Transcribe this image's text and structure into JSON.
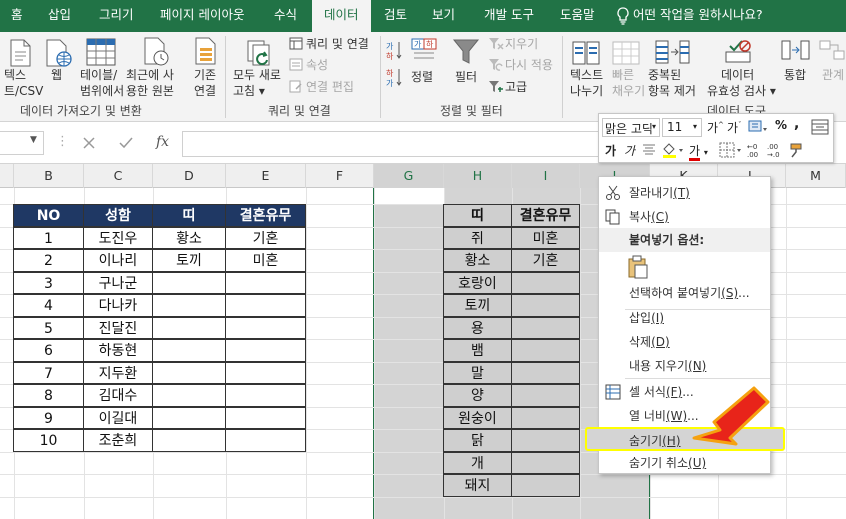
{
  "tabs": [
    "홈",
    "삽입",
    "그리기",
    "페이지 레이아웃",
    "수식",
    "데이터",
    "검토",
    "보기",
    "개발 도구",
    "도움말",
    "어떤 작업을 원하시나요?"
  ],
  "ribbon": {
    "get_data": {
      "btn_text_line1": "텍스",
      "btn_text_line2": "트/CSV",
      "btn_web": "웹",
      "btn_table_line1": "테이블/",
      "btn_table_line2": "범위에서",
      "btn_recent_line1": "최근에 사",
      "btn_recent_line2": "용한 원본",
      "btn_existing_line1": "기존",
      "btn_existing_line2": "연결",
      "group_label": "데이터 가져오기 및 변환"
    },
    "queries": {
      "refresh_line1": "모두 새로",
      "refresh_line2": "고침",
      "queries_conn": "쿼리 및 연결",
      "properties": "속성",
      "edit_links": "연결 편집",
      "group_label": "쿼리 및 연결"
    },
    "sort_filter": {
      "sort": "정렬",
      "filter": "필터",
      "clear": "지우기",
      "reapply": "다시 적용",
      "advanced": "고급",
      "group_label": "정렬 및 필터"
    },
    "data_tools": {
      "text_col_line1": "텍스트",
      "text_col_line2": "나누기",
      "flash_line1": "빠른",
      "flash_line2": "채우기",
      "remove_dup_line1": "중복된",
      "remove_dup_line2": "항목 제거",
      "validation_line1": "데이터",
      "validation_line2": "유효성 검사",
      "consolidate": "통합",
      "relations": "관계",
      "group_label": "데이터 도구"
    }
  },
  "formula_bar": {
    "fx": "fx"
  },
  "columns": [
    "B",
    "C",
    "D",
    "E",
    "F",
    "G",
    "H",
    "I",
    "J",
    "K",
    "L",
    "M"
  ],
  "table1": {
    "headers": [
      "NO",
      "성함",
      "띠",
      "결혼유무"
    ],
    "rows": [
      [
        "1",
        "도진우",
        "황소",
        "기혼"
      ],
      [
        "2",
        "이나리",
        "토끼",
        "미혼"
      ],
      [
        "3",
        "구나군",
        "",
        ""
      ],
      [
        "4",
        "다나카",
        "",
        ""
      ],
      [
        "5",
        "진달진",
        "",
        ""
      ],
      [
        "6",
        "하동현",
        "",
        ""
      ],
      [
        "7",
        "지두환",
        "",
        ""
      ],
      [
        "8",
        "김대수",
        "",
        ""
      ],
      [
        "9",
        "이길대",
        "",
        ""
      ],
      [
        "10",
        "조춘희",
        "",
        ""
      ]
    ]
  },
  "table2": {
    "headers": [
      "띠",
      "결혼유무"
    ],
    "rows": [
      [
        "쥐",
        "미혼"
      ],
      [
        "황소",
        "기혼"
      ],
      [
        "호랑이",
        ""
      ],
      [
        "토끼",
        ""
      ],
      [
        "용",
        ""
      ],
      [
        "뱀",
        ""
      ],
      [
        "말",
        ""
      ],
      [
        "양",
        ""
      ],
      [
        "원숭이",
        ""
      ],
      [
        "닭",
        ""
      ],
      [
        "개",
        ""
      ],
      [
        "돼지",
        ""
      ]
    ]
  },
  "mini_toolbar": {
    "font": "맑은 고딕",
    "size": "11",
    "percent": "%",
    "comma": ",",
    "bold": "가",
    "italic": "가",
    "font_color": "가"
  },
  "context_menu": {
    "cut": "잘라내기(T)",
    "copy": "복사(C)",
    "paste_options": "붙여넣기 옵션:",
    "paste_special": "선택하여 붙여넣기(S)...",
    "insert": "삽입(I)",
    "delete": "삭제(D)",
    "clear": "내용 지우기(N)",
    "format_cells": "셀 서식(F)...",
    "col_width": "열 너비(W)...",
    "hide": "숨기기(H)",
    "unhide": "숨기기 취소(U)"
  },
  "colors": {
    "excel_green": "#217346",
    "header_fill": "#1f3864",
    "highlight_yellow": "#ffff00",
    "arrow_red": "#e8241a",
    "arrow_orange": "#f5a10f"
  }
}
